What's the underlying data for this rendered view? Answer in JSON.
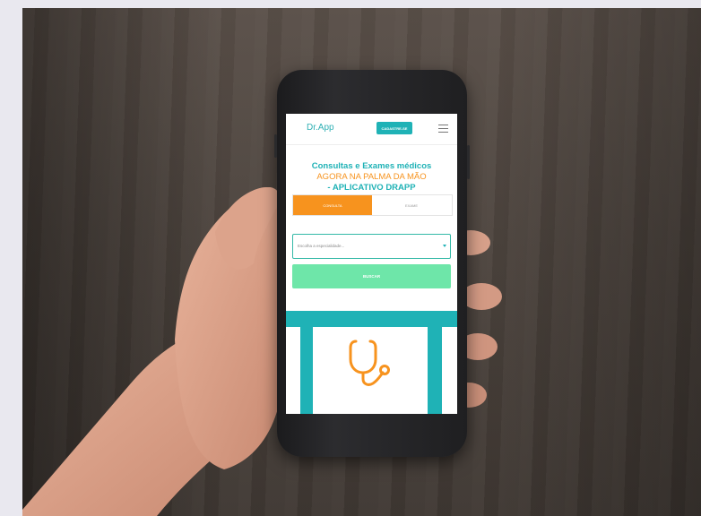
{
  "app": {
    "logo": "Dr.App",
    "signup_label": "CADASTRE-SE",
    "headline_line1": "Consultas e Exames médicos",
    "headline_line2": "AGORA NA PALMA DA MÃO",
    "headline_line3": "- APLICATIVO DRAPP",
    "tabs": [
      {
        "label": "CONSULTA",
        "active": true
      },
      {
        "label": "EXAME",
        "active": false
      }
    ],
    "specialty_placeholder": "Escolha a especialidade...",
    "search_label": "BUSCAR",
    "card_icon": "stethoscope-icon"
  },
  "colors": {
    "brand_teal": "#1fb2b6",
    "accent_orange": "#f7931e",
    "button_green": "#6ee6a9"
  }
}
